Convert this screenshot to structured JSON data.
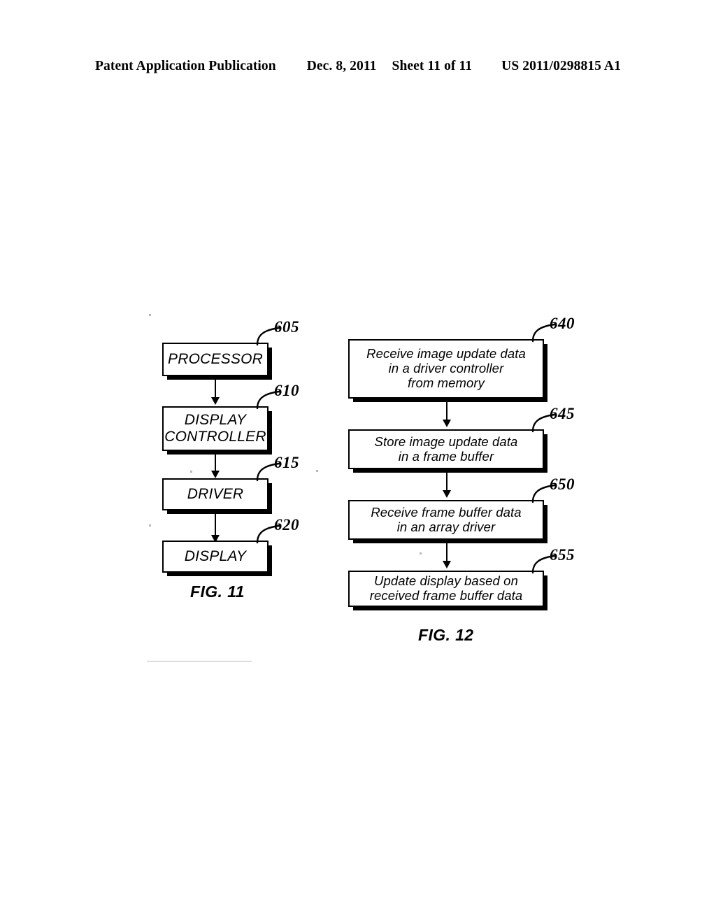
{
  "header": {
    "publication": "Patent Application Publication",
    "date": "Dec. 8, 2011",
    "sheet": "Sheet 11 of 11",
    "patent_number": "US 2011/0298815 A1"
  },
  "figures": [
    {
      "caption": "FIG. 11",
      "type": "block-diagram",
      "blocks": [
        {
          "ref": "605",
          "label": "PROCESSOR"
        },
        {
          "ref": "610",
          "label": "DISPLAY\nCONTROLLER",
          "line1": "DISPLAY",
          "line2": "CONTROLLER"
        },
        {
          "ref": "615",
          "label": "DRIVER"
        },
        {
          "ref": "620",
          "label": "DISPLAY"
        }
      ]
    },
    {
      "caption": "FIG. 12",
      "type": "flowchart",
      "blocks": [
        {
          "ref": "640",
          "line1": "Receive image update data",
          "line2": "in a driver controller",
          "line3": "from memory"
        },
        {
          "ref": "645",
          "line1": "Store image update data",
          "line2": "in a frame buffer"
        },
        {
          "ref": "650",
          "line1": "Receive frame buffer data",
          "line2": "in an array driver"
        },
        {
          "ref": "655",
          "line1": "Update display based on",
          "line2": "received frame buffer data"
        }
      ]
    }
  ],
  "colors": {
    "ink": "#000000",
    "paper": "#ffffff"
  }
}
